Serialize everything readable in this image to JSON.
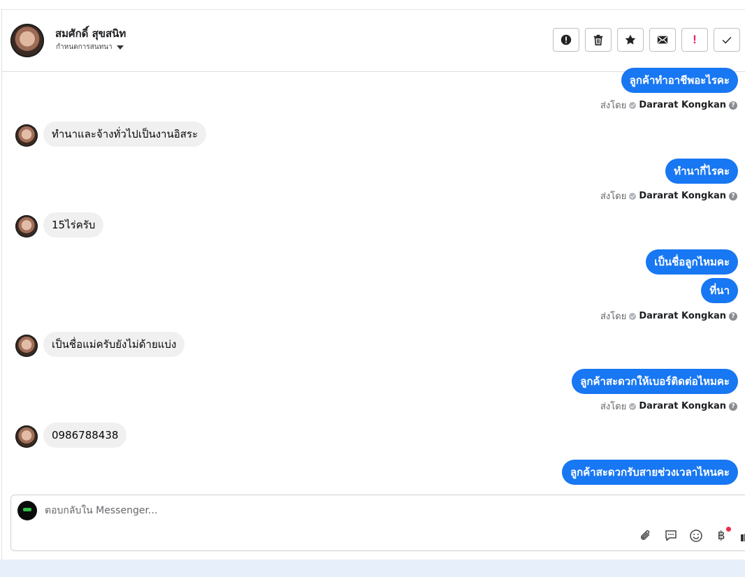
{
  "header": {
    "contact_name": "สมศักดิ์ สุขสนิท",
    "assign_label": "กำหนดการสนทนา",
    "actions": [
      {
        "name": "report-button",
        "icon": "alert-circle-icon"
      },
      {
        "name": "delete-button",
        "icon": "trash-icon"
      },
      {
        "name": "star-button",
        "icon": "star-icon"
      },
      {
        "name": "mark-unread-button",
        "icon": "envelope-icon"
      },
      {
        "name": "important-button",
        "icon": "exclamation-icon"
      },
      {
        "name": "done-button",
        "icon": "check-icon"
      }
    ]
  },
  "messages": {
    "out_1": "ลูกค้าทำอาชีพอะไรคะ",
    "in_1": "ทำนาและจ้างทั่วไปเป็นงานอิสระ",
    "out_2": "ทำนากี่ไรคะ",
    "in_2": "15ไร่ครับ",
    "out_3a": "เป็นชื่อลูกไหมคะ",
    "out_3b": "ที่นา",
    "in_3": "เป็นชื่อแม่ครับยังไม่ด้ายแบ่ง",
    "out_4": "ลูกค้าสะดวกให้เบอร์ติดต่อไหมคะ",
    "in_4": "0986788438",
    "out_5": "ลูกค้าสะดวกรับสายช่วงเวลาไหนคะ"
  },
  "sent_by": {
    "label": "ส่งโดย",
    "agent": "Dararat Kongkan"
  },
  "composer": {
    "placeholder": "ตอบกลับใน Messenger...",
    "tools": [
      "paperclip-icon",
      "saved-reply-icon",
      "emoji-icon",
      "baht-icon",
      "like-icon"
    ]
  },
  "colors": {
    "outgoing_bubble": "#1877f2",
    "incoming_bubble": "#f0f0f0",
    "alert": "#e0245e"
  }
}
